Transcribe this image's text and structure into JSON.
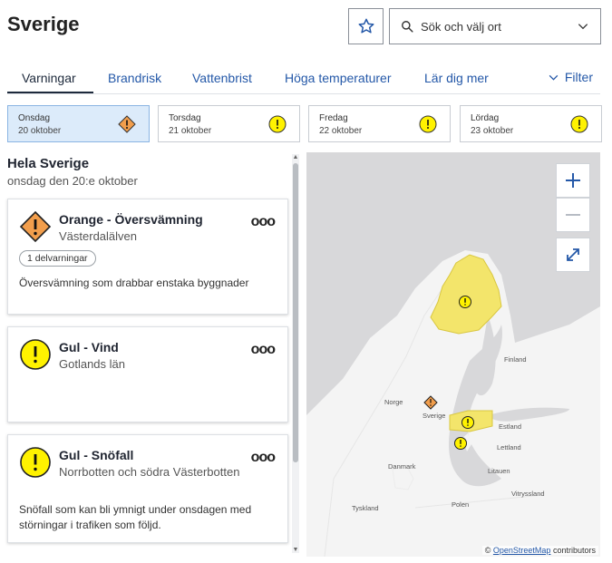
{
  "header": {
    "title": "Sverige",
    "search_placeholder": "Sök och välj ort"
  },
  "tabs": [
    {
      "label": "Varningar",
      "active": true
    },
    {
      "label": "Brandrisk",
      "active": false
    },
    {
      "label": "Vattenbrist",
      "active": false
    },
    {
      "label": "Höga temperaturer",
      "active": false
    },
    {
      "label": "Lär dig mer",
      "active": false
    }
  ],
  "filter_label": "Filter",
  "days": [
    {
      "day": "Onsdag",
      "date": "20 oktober",
      "level": "orange",
      "selected": true
    },
    {
      "day": "Torsdag",
      "date": "21 oktober",
      "level": "yellow",
      "selected": false
    },
    {
      "day": "Fredag",
      "date": "22 oktober",
      "level": "yellow",
      "selected": false
    },
    {
      "day": "Lördag",
      "date": "23 oktober",
      "level": "yellow",
      "selected": false
    }
  ],
  "region": {
    "title": "Hela Sverige",
    "subtitle": "onsdag den 20:e oktober"
  },
  "warnings": [
    {
      "title": "Orange - Översvämning",
      "area": "Västerdalälven",
      "chip": "1 delvarningar",
      "description": "Översvämning som drabbar enstaka byggnader",
      "level": "orange"
    },
    {
      "title": "Gul - Vind",
      "area": "Gotlands län",
      "level": "yellow"
    },
    {
      "title": "Gul - Snöfall",
      "area": "Norrbotten och södra Västerbotten",
      "description": "Snöfall som kan bli ymnigt under onsdagen med störningar i trafiken som följd.",
      "level": "yellow"
    }
  ],
  "map": {
    "labels": {
      "finland": "Finland",
      "norge": "Norge",
      "sverige": "Sverige",
      "estland": "Estland",
      "lettland": "Lettland",
      "danmark": "Danmark",
      "litauen": "Litauen",
      "vitryssland": "Vitryssland",
      "polen": "Polen",
      "tyskland": "Tyskland"
    },
    "attribution_prefix": "©",
    "attribution_link": "OpenStreetMap",
    "attribution_suffix": "contributors"
  },
  "colors": {
    "orange": "#f29e4c",
    "yellow": "#fff200",
    "map_land": "#f4f4f4",
    "map_water": "#d8d8da",
    "warn_area": "#f3e56b",
    "link": "#2458a8"
  }
}
